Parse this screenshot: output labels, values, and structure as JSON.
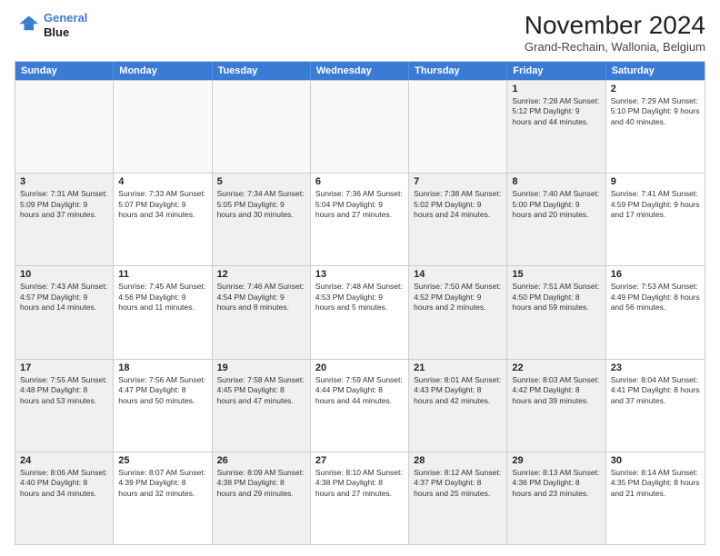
{
  "header": {
    "logo_line1": "General",
    "logo_line2": "Blue",
    "month_title": "November 2024",
    "location": "Grand-Rechain, Wallonia, Belgium"
  },
  "days_of_week": [
    "Sunday",
    "Monday",
    "Tuesday",
    "Wednesday",
    "Thursday",
    "Friday",
    "Saturday"
  ],
  "weeks": [
    [
      {
        "day": "",
        "info": "",
        "empty": true
      },
      {
        "day": "",
        "info": "",
        "empty": true
      },
      {
        "day": "",
        "info": "",
        "empty": true
      },
      {
        "day": "",
        "info": "",
        "empty": true
      },
      {
        "day": "",
        "info": "",
        "empty": true
      },
      {
        "day": "1",
        "info": "Sunrise: 7:28 AM\nSunset: 5:12 PM\nDaylight: 9 hours and 44 minutes.",
        "shaded": true
      },
      {
        "day": "2",
        "info": "Sunrise: 7:29 AM\nSunset: 5:10 PM\nDaylight: 9 hours and 40 minutes."
      }
    ],
    [
      {
        "day": "3",
        "info": "Sunrise: 7:31 AM\nSunset: 5:09 PM\nDaylight: 9 hours and 37 minutes.",
        "shaded": true
      },
      {
        "day": "4",
        "info": "Sunrise: 7:33 AM\nSunset: 5:07 PM\nDaylight: 9 hours and 34 minutes."
      },
      {
        "day": "5",
        "info": "Sunrise: 7:34 AM\nSunset: 5:05 PM\nDaylight: 9 hours and 30 minutes.",
        "shaded": true
      },
      {
        "day": "6",
        "info": "Sunrise: 7:36 AM\nSunset: 5:04 PM\nDaylight: 9 hours and 27 minutes."
      },
      {
        "day": "7",
        "info": "Sunrise: 7:38 AM\nSunset: 5:02 PM\nDaylight: 9 hours and 24 minutes.",
        "shaded": true
      },
      {
        "day": "8",
        "info": "Sunrise: 7:40 AM\nSunset: 5:00 PM\nDaylight: 9 hours and 20 minutes.",
        "shaded": true
      },
      {
        "day": "9",
        "info": "Sunrise: 7:41 AM\nSunset: 4:59 PM\nDaylight: 9 hours and 17 minutes."
      }
    ],
    [
      {
        "day": "10",
        "info": "Sunrise: 7:43 AM\nSunset: 4:57 PM\nDaylight: 9 hours and 14 minutes.",
        "shaded": true
      },
      {
        "day": "11",
        "info": "Sunrise: 7:45 AM\nSunset: 4:56 PM\nDaylight: 9 hours and 11 minutes."
      },
      {
        "day": "12",
        "info": "Sunrise: 7:46 AM\nSunset: 4:54 PM\nDaylight: 9 hours and 8 minutes.",
        "shaded": true
      },
      {
        "day": "13",
        "info": "Sunrise: 7:48 AM\nSunset: 4:53 PM\nDaylight: 9 hours and 5 minutes."
      },
      {
        "day": "14",
        "info": "Sunrise: 7:50 AM\nSunset: 4:52 PM\nDaylight: 9 hours and 2 minutes.",
        "shaded": true
      },
      {
        "day": "15",
        "info": "Sunrise: 7:51 AM\nSunset: 4:50 PM\nDaylight: 8 hours and 59 minutes.",
        "shaded": true
      },
      {
        "day": "16",
        "info": "Sunrise: 7:53 AM\nSunset: 4:49 PM\nDaylight: 8 hours and 56 minutes."
      }
    ],
    [
      {
        "day": "17",
        "info": "Sunrise: 7:55 AM\nSunset: 4:48 PM\nDaylight: 8 hours and 53 minutes.",
        "shaded": true
      },
      {
        "day": "18",
        "info": "Sunrise: 7:56 AM\nSunset: 4:47 PM\nDaylight: 8 hours and 50 minutes."
      },
      {
        "day": "19",
        "info": "Sunrise: 7:58 AM\nSunset: 4:45 PM\nDaylight: 8 hours and 47 minutes.",
        "shaded": true
      },
      {
        "day": "20",
        "info": "Sunrise: 7:59 AM\nSunset: 4:44 PM\nDaylight: 8 hours and 44 minutes."
      },
      {
        "day": "21",
        "info": "Sunrise: 8:01 AM\nSunset: 4:43 PM\nDaylight: 8 hours and 42 minutes.",
        "shaded": true
      },
      {
        "day": "22",
        "info": "Sunrise: 8:03 AM\nSunset: 4:42 PM\nDaylight: 8 hours and 39 minutes.",
        "shaded": true
      },
      {
        "day": "23",
        "info": "Sunrise: 8:04 AM\nSunset: 4:41 PM\nDaylight: 8 hours and 37 minutes."
      }
    ],
    [
      {
        "day": "24",
        "info": "Sunrise: 8:06 AM\nSunset: 4:40 PM\nDaylight: 8 hours and 34 minutes.",
        "shaded": true
      },
      {
        "day": "25",
        "info": "Sunrise: 8:07 AM\nSunset: 4:39 PM\nDaylight: 8 hours and 32 minutes."
      },
      {
        "day": "26",
        "info": "Sunrise: 8:09 AM\nSunset: 4:38 PM\nDaylight: 8 hours and 29 minutes.",
        "shaded": true
      },
      {
        "day": "27",
        "info": "Sunrise: 8:10 AM\nSunset: 4:38 PM\nDaylight: 8 hours and 27 minutes."
      },
      {
        "day": "28",
        "info": "Sunrise: 8:12 AM\nSunset: 4:37 PM\nDaylight: 8 hours and 25 minutes.",
        "shaded": true
      },
      {
        "day": "29",
        "info": "Sunrise: 8:13 AM\nSunset: 4:36 PM\nDaylight: 8 hours and 23 minutes.",
        "shaded": true
      },
      {
        "day": "30",
        "info": "Sunrise: 8:14 AM\nSunset: 4:35 PM\nDaylight: 8 hours and 21 minutes."
      }
    ]
  ]
}
